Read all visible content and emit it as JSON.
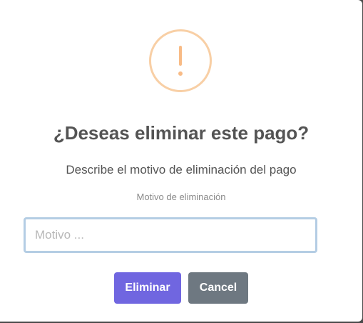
{
  "dialog": {
    "icon": "warning-icon",
    "title": "¿Deseas eliminar este pago?",
    "message": "Describe el motivo de eliminación del pago",
    "input_label": "Motivo de eliminación",
    "input_placeholder": "Motivo ...",
    "input_value": "",
    "confirm_label": "Eliminar",
    "cancel_label": "Cancel"
  },
  "colors": {
    "warning": "#f8bb86",
    "confirm": "#7066e0",
    "cancel": "#6e7881",
    "input_focus_border": "#b4cde4"
  }
}
